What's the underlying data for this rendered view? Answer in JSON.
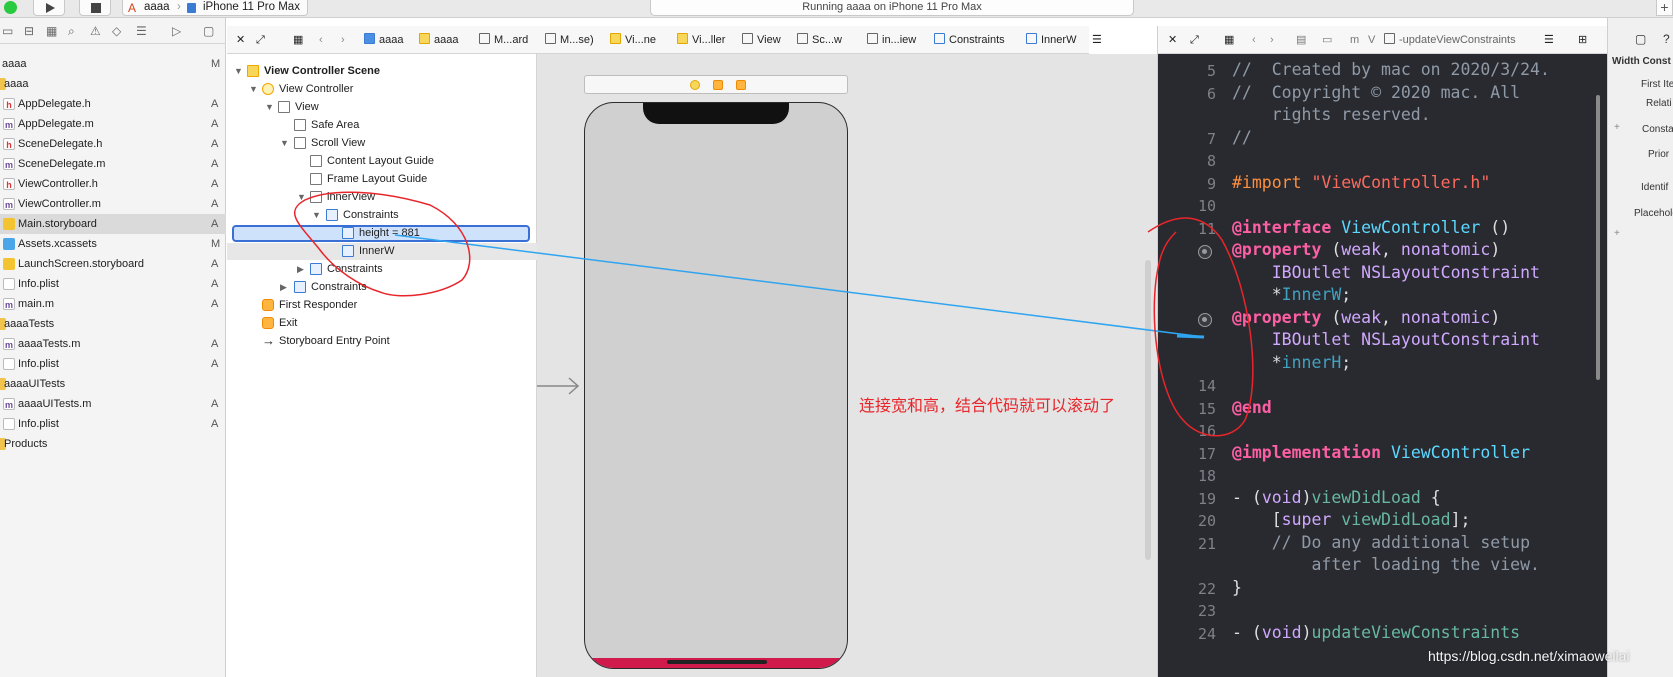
{
  "toolbar": {
    "scheme_target": "aaaa",
    "scheme_device": "iPhone 11 Pro Max",
    "status": "Running aaaa on iPhone 11 Pro Max"
  },
  "navigator": {
    "root_label": "aaaa",
    "root_status": "M",
    "items": [
      {
        "label": "aaaa",
        "kind": "folder",
        "status": ""
      },
      {
        "label": "AppDelegate.h",
        "kind": "h",
        "status": "A"
      },
      {
        "label": "AppDelegate.m",
        "kind": "m",
        "status": "A"
      },
      {
        "label": "SceneDelegate.h",
        "kind": "h",
        "status": "A"
      },
      {
        "label": "SceneDelegate.m",
        "kind": "m",
        "status": "A"
      },
      {
        "label": "ViewController.h",
        "kind": "h",
        "status": "A"
      },
      {
        "label": "ViewController.m",
        "kind": "m",
        "status": "A"
      },
      {
        "label": "Main.storyboard",
        "kind": "sb",
        "status": "A"
      },
      {
        "label": "Assets.xcassets",
        "kind": "asset",
        "status": "M"
      },
      {
        "label": "LaunchScreen.storyboard",
        "kind": "sb",
        "status": "A"
      },
      {
        "label": "Info.plist",
        "kind": "plist",
        "status": "A"
      },
      {
        "label": "main.m",
        "kind": "m",
        "status": "A"
      },
      {
        "label": "aaaaTests",
        "kind": "folder",
        "status": ""
      },
      {
        "label": "aaaaTests.m",
        "kind": "m",
        "status": "A"
      },
      {
        "label": "Info.plist",
        "kind": "plist",
        "status": "A"
      },
      {
        "label": "aaaaUITests",
        "kind": "folder",
        "status": ""
      },
      {
        "label": "aaaaUITests.m",
        "kind": "m",
        "status": "A"
      },
      {
        "label": "Info.plist",
        "kind": "plist",
        "status": "A"
      },
      {
        "label": "Products",
        "kind": "folder",
        "status": ""
      }
    ]
  },
  "ib_jumpbar": {
    "crumbs": [
      "aaaa",
      "aaaa",
      "M...ard",
      "M...se)",
      "Vi...ne",
      "Vi...ller",
      "View",
      "Sc...w",
      "in...iew",
      "Constraints",
      "InnerW"
    ]
  },
  "outline": {
    "rows": [
      {
        "label": "View Controller Scene",
        "bold": true
      },
      {
        "label": "View Controller"
      },
      {
        "label": "View"
      },
      {
        "label": "Safe Area"
      },
      {
        "label": "Scroll View"
      },
      {
        "label": "Content Layout Guide"
      },
      {
        "label": "Frame Layout Guide"
      },
      {
        "label": "innerView"
      },
      {
        "label": "Constraints"
      },
      {
        "label": "height = 881"
      },
      {
        "label": "InnerW"
      },
      {
        "label": "Constraints"
      },
      {
        "label": "Constraints"
      },
      {
        "label": "First Responder"
      },
      {
        "label": "Exit"
      },
      {
        "label": "Storyboard Entry Point"
      }
    ]
  },
  "editor_jumpbar": {
    "method": "-updateViewConstraints"
  },
  "editor": {
    "lines": [
      {
        "n": "5",
        "text": "//  Created by mac on 2020/3/24."
      },
      {
        "n": "6",
        "text": "//  Copyright © 2020 mac. All"
      },
      {
        "n": "",
        "text": "    rights reserved."
      },
      {
        "n": "7",
        "text": "//"
      },
      {
        "n": "8",
        "text": ""
      },
      {
        "n": "9",
        "text": "#import \"ViewController.h\""
      },
      {
        "n": "10",
        "text": ""
      },
      {
        "n": "11",
        "text": "@interface ViewController ()"
      },
      {
        "n": "",
        "text": "@property (weak, nonatomic)"
      },
      {
        "n": "",
        "text": "    IBOutlet NSLayoutConstraint"
      },
      {
        "n": "",
        "text": "    *InnerW;"
      },
      {
        "n": "",
        "text": "@property (weak, nonatomic)"
      },
      {
        "n": "",
        "text": "    IBOutlet NSLayoutConstraint"
      },
      {
        "n": "",
        "text": "    *innerH;"
      },
      {
        "n": "14",
        "text": ""
      },
      {
        "n": "15",
        "text": "@end"
      },
      {
        "n": "16",
        "text": ""
      },
      {
        "n": "17",
        "text": "@implementation ViewController"
      },
      {
        "n": "18",
        "text": ""
      },
      {
        "n": "19",
        "text": "- (void)viewDidLoad {"
      },
      {
        "n": "20",
        "text": "    [super viewDidLoad];"
      },
      {
        "n": "21",
        "text": "    // Do any additional setup"
      },
      {
        "n": "",
        "text": "        after loading the view."
      },
      {
        "n": "22",
        "text": "}"
      },
      {
        "n": "23",
        "text": ""
      },
      {
        "n": "24",
        "text": "- (void)updateViewConstraints"
      }
    ]
  },
  "inspector": {
    "title": "Width Const",
    "fields": [
      "First Ite",
      "Relati",
      "Consta",
      "Prior",
      "Identif",
      "Placeholo"
    ]
  },
  "annotation": "连接宽和高，结合代码就可以滚动了",
  "watermark": "https://blog.csdn.net/ximaoweilai",
  "colors": {
    "accent": "#3a6fd6",
    "annotation_red": "#e8252a",
    "connection_line": "#2fa4f0",
    "editor_bg": "#292a30"
  }
}
